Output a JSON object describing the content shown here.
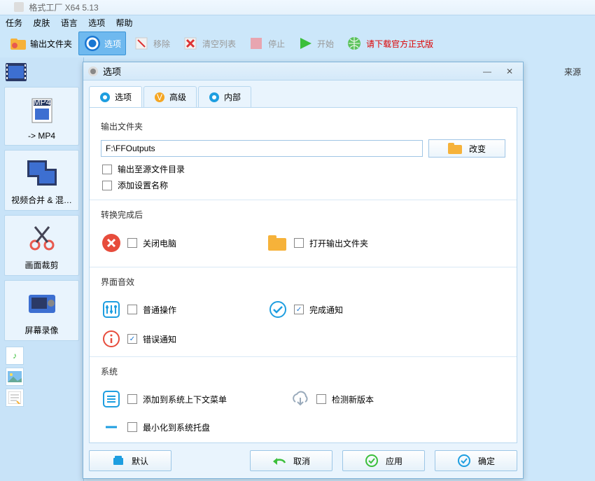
{
  "window": {
    "title": "格式工厂 X64 5.13"
  },
  "menu": {
    "tasks": "任务",
    "skin": "皮肤",
    "language": "语言",
    "options": "选项",
    "help": "帮助"
  },
  "toolbar": {
    "output_folder": "输出文件夹",
    "options": "选项",
    "remove": "移除",
    "clear_list": "清空列表",
    "stop": "停止",
    "start": "开始",
    "download_official": "请下载官方正式版"
  },
  "left": {
    "to_mp4": "-> MP4",
    "video_merge": "视频合并 & 混…",
    "crop": "画面裁剪",
    "screen_record": "屏幕录像"
  },
  "right": {
    "source": "来源"
  },
  "dialog": {
    "title": "选项",
    "tabs": {
      "options": "选项",
      "advanced": "高级",
      "internal": "内部"
    },
    "sections": {
      "output_folder": "输出文件夹",
      "after_convert": "转换完成后",
      "ui_sounds": "界面音效",
      "system": "系统"
    },
    "output": {
      "path": "F:\\FFOutputs",
      "change": "改变",
      "output_to_source_dir": "输出至源文件目录",
      "append_setting_name": "添加设置名称"
    },
    "after": {
      "shutdown": "关闭电脑",
      "open_output": "打开输出文件夹"
    },
    "sounds": {
      "normal_ops": "普通操作",
      "finish_notify": "完成通知",
      "error_notify": "错误通知"
    },
    "system": {
      "add_context_menu": "添加到系统上下文菜单",
      "check_update": "检测新版本",
      "minimize_to_tray": "最小化到系统托盘"
    },
    "buttons": {
      "default": "默认",
      "cancel": "取消",
      "apply": "应用",
      "ok": "确定"
    },
    "checked": {
      "finish_notify": true,
      "error_notify": true
    }
  }
}
